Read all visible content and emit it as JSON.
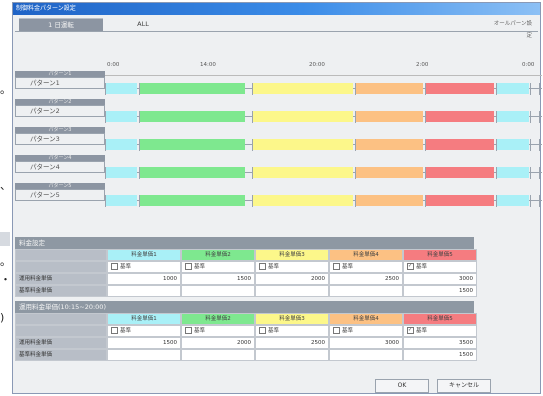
{
  "title": "制御料金パターン設定",
  "tabs": [
    {
      "label": "1 日運転",
      "active": true
    },
    {
      "label": "ALL",
      "active": false
    }
  ],
  "top_right": "オールパーン設定",
  "side_marks": [
    "。",
    "、",
    "。",
    "・",
    ")"
  ],
  "patterns": [
    {
      "header": "パターン1",
      "label": "パターン1"
    },
    {
      "header": "パターン2",
      "label": "パターン2"
    },
    {
      "header": "パターン3",
      "label": "パターン3"
    },
    {
      "header": "パターン4",
      "label": "パターン4"
    },
    {
      "header": "パターン5",
      "label": "パターン5"
    }
  ],
  "scale_labels": [
    "0:00",
    "14:00",
    "20:00",
    "2:00",
    "0:00"
  ],
  "price_colors": [
    "#a9f0f7",
    "#7ee88f",
    "#fcf78a",
    "#fcc183",
    "#f57c80"
  ],
  "table1": {
    "title": "料金設定",
    "headers": [
      "料金単価1",
      "料金単価2",
      "料金単価3",
      "料金単価4",
      "料金単価5"
    ],
    "row_check": {
      "labels": [
        "基準",
        "基準",
        "基準",
        "基準",
        "基準"
      ],
      "checked": [
        false,
        false,
        false,
        false,
        true
      ]
    },
    "rows": [
      {
        "label": "運用料金単価",
        "values": [
          "1000",
          "1500",
          "2000",
          "2500",
          "3000"
        ]
      },
      {
        "label": "基準料金単価",
        "values": [
          "",
          "",
          "",
          "",
          "1500"
        ]
      }
    ]
  },
  "table2": {
    "title": "運用料金単価(10:15~20:00)",
    "headers": [
      "料金単価1",
      "料金単価2",
      "料金単価3",
      "料金単価4",
      "料金単価5"
    ],
    "row_check": {
      "labels": [
        "基準",
        "基準",
        "基準",
        "基準",
        "基準"
      ],
      "checked": [
        false,
        false,
        false,
        false,
        true
      ]
    },
    "rows": [
      {
        "label": "運用料金単価",
        "values": [
          "1500",
          "2000",
          "2500",
          "3000",
          "3500"
        ]
      },
      {
        "label": "基準料金単価",
        "values": [
          "",
          "",
          "",
          "",
          "1500"
        ]
      }
    ]
  },
  "buttons": {
    "ok": "OK",
    "cancel": "キャンセル"
  }
}
